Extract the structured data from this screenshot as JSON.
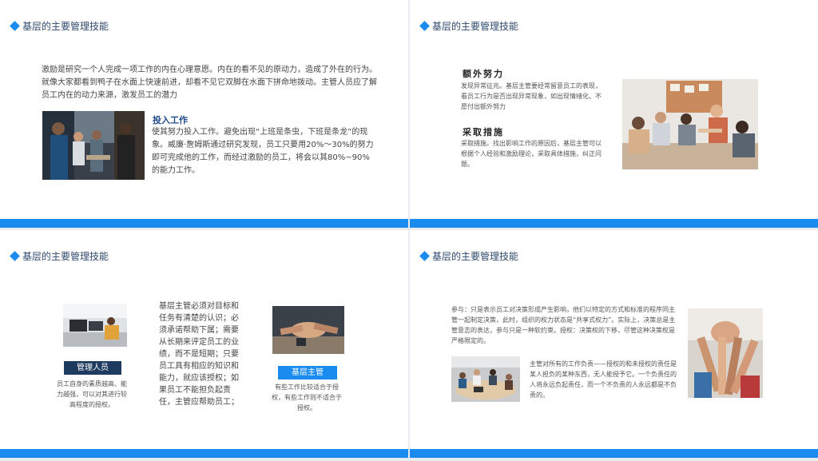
{
  "slides": [
    {
      "title": "基层的主要管理技能",
      "intro": "激励是研究一个人完成一项工作的内在心理意愿。内在的看不见的原动力，造成了外在的行为。就像大家都看到鸭子在水面上快速前进，却看不见它双脚在水面下拼命地拨动。主管人员应了解员工内在的动力来源，激发员工的潜力",
      "section_heading": "投入工作",
      "section_text": "使其努力投入工作。避免出现“上班是条虫，下班是条龙”的现象。威廉·詹姆斯通过研究发现，员工只要用20%～30%的努力即可完成他的工作，而经过激励的员工，将会以其80%~90%的能力工作。"
    },
    {
      "title": "基层的主要管理技能",
      "heading_1": "额外努力",
      "text_1": "发现异常征兆。基层主管要经常留意员工的表现，看员工行为是否出现异常现象，如出现情绪化、不愿付出额外努力",
      "heading_2": "采取措施",
      "text_2": "采取措施。找出影响工作的原因后，基层主管可以根据个人经验和激励理论，采取具体措施，纠正问题。"
    },
    {
      "title": "基层的主要管理技能",
      "label_left": "管理人员",
      "text_left": "员工自身的素质越高、能力越强，可以对其进行较高程度的授权。",
      "center_text": "基层主管必须对目标和任务有清楚的认识；必须承诺帮助下属；需要从长期来评定员工的业绩，而不是短期；只要员工具有相应的知识和能力，就应该授权；如果员工不能担负起责任，主管应帮助员工；",
      "label_right": "基层主管",
      "text_right": "有些工作比较适合于授权，有些工作则不适合于授权。"
    },
    {
      "title": "基层的主要管理技能",
      "text_top": "参与：只是表示员工对决策形成产生影响，他们以特定的方式和标准的程序同主管一起制定决策，此时，组织的权力状态是“共享式权力”。实际上，决策总是主管意志的表达，参与只是一种软约束。授权：决策权的下移，尽管这种决策权是严格限定的。",
      "text_mid": "主管对所有的工作负责——授权的和未授权的责任是某人担负的某种东西，无人能授予它。一个负责任的人将永远负起责任，而一个不负责的人永远都是不负责的。"
    }
  ],
  "colors": {
    "accent": "#1a8cf0",
    "label_dark": "#1f3a5f",
    "label_blue": "#1a8cf0"
  }
}
